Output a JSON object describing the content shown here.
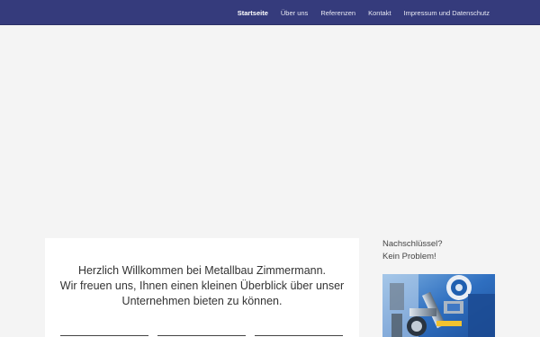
{
  "nav": {
    "items": [
      {
        "label": "Startseite",
        "active": true
      },
      {
        "label": "Über uns",
        "active": false
      },
      {
        "label": "Referenzen",
        "active": false
      },
      {
        "label": "Kontakt",
        "active": false
      },
      {
        "label": "Impressum und Datenschutz",
        "active": false
      }
    ]
  },
  "main": {
    "welcome_line1": "Herzlich Willkommen bei Metallbau Zimmermann.",
    "welcome_line2": "Wir freuen uns, Ihnen einen kleinen Überblick über unser",
    "welcome_line3": "Unternehmen bieten zu können."
  },
  "sidebar": {
    "title_line1": "Nachschlüssel?",
    "title_line2": "Kein Problem!"
  },
  "colors": {
    "nav_bg": "#353b7c",
    "page_bg": "#f4f4f4",
    "card_bg": "#ffffff",
    "image_blue": "#3a78c6"
  }
}
